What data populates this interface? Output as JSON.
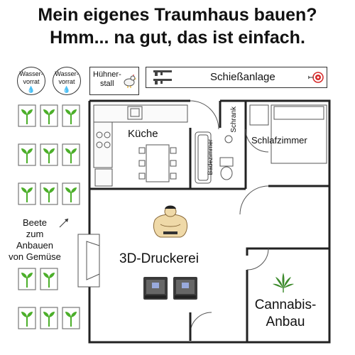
{
  "title": {
    "line1": "Mein eigenes Traumhaus bauen?",
    "line2": "Hmm... na gut, das ist einfach."
  },
  "tanks": [
    {
      "label_l1": "Wasser-",
      "label_l2": "vorrat"
    },
    {
      "label_l1": "Wasser-",
      "label_l2": "vorrat"
    }
  ],
  "chicken": {
    "l1": "Hühner-",
    "l2": "stall"
  },
  "range": {
    "label": "Schießanlage"
  },
  "rooms": {
    "kitchen": "Küche",
    "closet": "Schrank",
    "bathroom": "Badezimmer",
    "bedroom": "Schlafzimmer",
    "printshop": "3D-Druckerei",
    "cannabis_l1": "Cannabis-",
    "cannabis_l2": "Anbau"
  },
  "beds_note": {
    "l1": "Beete",
    "l2": "zum",
    "l3": "Anbauen",
    "l4": "von Gemüse"
  },
  "colors": {
    "plant": "#4caf2a",
    "cannabis": "#3c8a2b",
    "drop": "#1e6fd6",
    "target": "#d62828"
  }
}
